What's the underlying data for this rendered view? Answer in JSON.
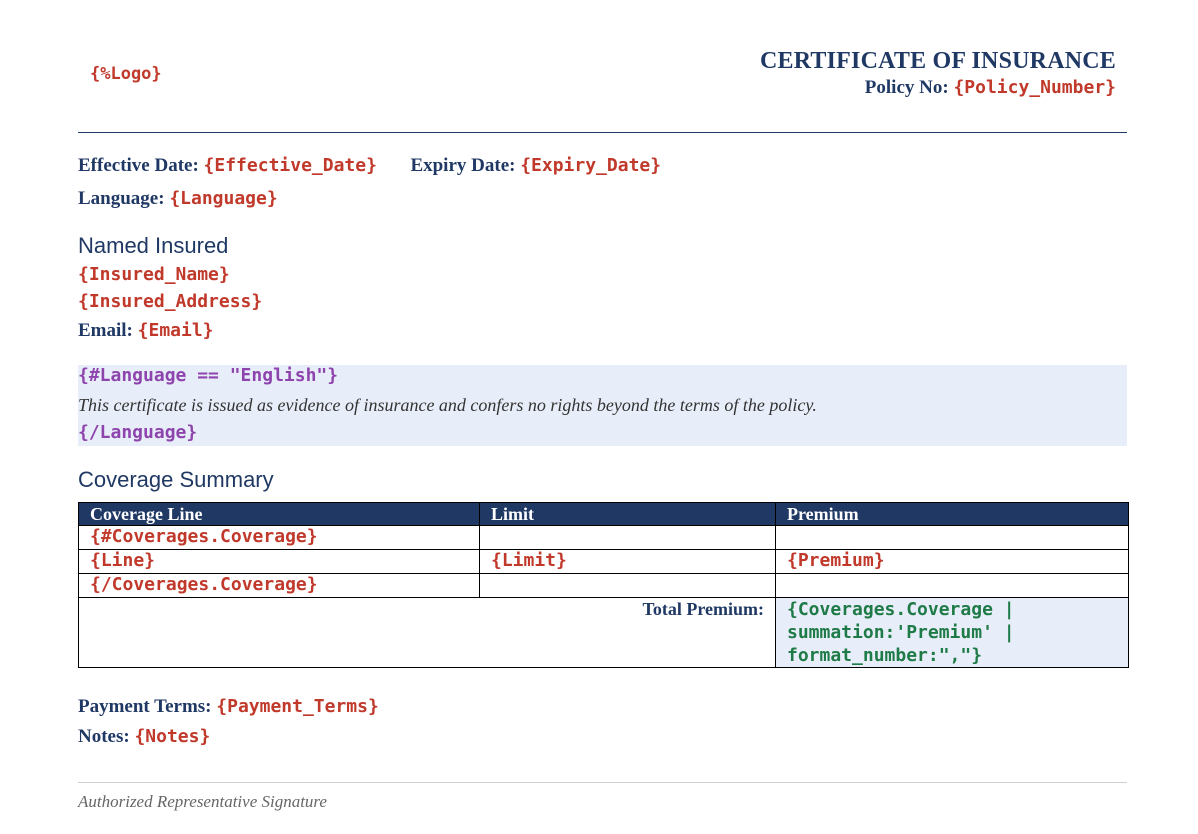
{
  "header": {
    "logo_tag": "{%Logo}",
    "title": "CERTIFICATE OF INSURANCE",
    "policy_label": "Policy No:",
    "policy_tag": "{Policy_Number}"
  },
  "dates": {
    "effective_label": "Effective Date:",
    "effective_tag": "{Effective_Date}",
    "expiry_label": "Expiry Date:",
    "expiry_tag": "{Expiry_Date}",
    "language_label": "Language:",
    "language_tag": "{Language}"
  },
  "insured": {
    "heading": "Named Insured",
    "name_tag": "{Insured_Name}",
    "address_tag": "{Insured_Address}",
    "email_label": "Email:",
    "email_tag": "{Email}"
  },
  "condition": {
    "open": "{#Language == \"English\"}",
    "text": "This certificate is issued as evidence of insurance and confers no rights beyond the terms of the policy.",
    "close": "{/Language}"
  },
  "coverage": {
    "heading": "Coverage Summary",
    "columns": [
      "Coverage Line",
      "Limit",
      "Premium"
    ],
    "loop_open": "{#Coverages.Coverage}",
    "row": {
      "line": "{Line}",
      "limit": "{Limit}",
      "premium": "{Premium}"
    },
    "loop_close": "{/Coverages.Coverage}",
    "total_label": "Total Premium:",
    "total_lines": [
      "{Coverages.Coverage |",
      "summation:'Premium' |",
      "format_number:\",\"}"
    ]
  },
  "footer": {
    "payment_label": "Payment Terms:",
    "payment_tag": "{Payment_Terms}",
    "notes_label": "Notes:",
    "notes_tag": "{Notes}",
    "signature": "Authorized Representative Signature"
  },
  "colors": {
    "navy": "#1f3864",
    "tag_red": "#c0392b",
    "tag_purple": "#8e44ad",
    "tag_green": "#1e7a46",
    "highlight": "#e8eef9"
  }
}
